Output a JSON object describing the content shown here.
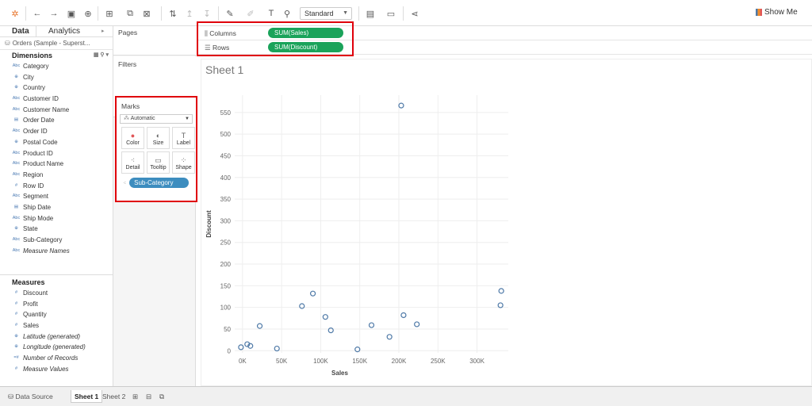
{
  "toolbar": {
    "view_mode": "Standard",
    "show_me": "Show Me",
    "icons": [
      "tableau-logo-icon",
      "undo-icon",
      "redo-icon",
      "save-icon",
      "add-datasource-icon",
      "new-worksheet-icon",
      "duplicate-icon",
      "clear-icon",
      "swap-icon",
      "sort-asc-icon",
      "sort-desc-icon",
      "highlight-icon",
      "group-icon",
      "label-icon",
      "pin-icon",
      "chart-icon",
      "presentation-icon",
      "share-icon"
    ]
  },
  "data_pane": {
    "tabs": [
      "Data",
      "Analytics"
    ],
    "datasource": "Orders (Sample - Superst...",
    "dimensions_title": "Dimensions",
    "dimensions": [
      {
        "type": "Abc",
        "label": "Category"
      },
      {
        "type": "globe",
        "label": "City"
      },
      {
        "type": "globe",
        "label": "Country"
      },
      {
        "type": "Abc",
        "label": "Customer ID"
      },
      {
        "type": "Abc",
        "label": "Customer Name"
      },
      {
        "type": "date",
        "label": "Order Date"
      },
      {
        "type": "Abc",
        "label": "Order ID"
      },
      {
        "type": "globe",
        "label": "Postal Code"
      },
      {
        "type": "Abc",
        "label": "Product ID"
      },
      {
        "type": "Abc",
        "label": "Product Name"
      },
      {
        "type": "Abc",
        "label": "Region"
      },
      {
        "type": "#",
        "label": "Row ID"
      },
      {
        "type": "Abc",
        "label": "Segment"
      },
      {
        "type": "date",
        "label": "Ship Date"
      },
      {
        "type": "Abc",
        "label": "Ship Mode"
      },
      {
        "type": "globe",
        "label": "State"
      },
      {
        "type": "Abc",
        "label": "Sub-Category"
      },
      {
        "type": "Abc",
        "label": "Measure Names",
        "italic": true
      }
    ],
    "measures_title": "Measures",
    "measures": [
      {
        "type": "#",
        "label": "Discount"
      },
      {
        "type": "#",
        "label": "Profit"
      },
      {
        "type": "#",
        "label": "Quantity"
      },
      {
        "type": "#",
        "label": "Sales"
      },
      {
        "type": "globe",
        "label": "Latitude (generated)",
        "italic": true
      },
      {
        "type": "globe",
        "label": "Longitude (generated)",
        "italic": true
      },
      {
        "type": "=#",
        "label": "Number of Records",
        "italic": true
      },
      {
        "type": "#",
        "label": "Measure Values",
        "italic": true
      }
    ]
  },
  "cards": {
    "pages": "Pages",
    "filters": "Filters",
    "marks": "Marks",
    "marks_type": "Automatic",
    "mark_buttons": [
      {
        "label": "Color",
        "icon": "color-icon"
      },
      {
        "label": "Size",
        "icon": "size-icon"
      },
      {
        "label": "Label",
        "icon": "label-icon"
      },
      {
        "label": "Detail",
        "icon": "detail-icon"
      },
      {
        "label": "Tooltip",
        "icon": "tooltip-icon"
      },
      {
        "label": "Shape",
        "icon": "shape-icon"
      }
    ],
    "detail_pill": "Sub-Category"
  },
  "shelves": {
    "columns_label": "Columns",
    "columns_pill": "SUM(Sales)",
    "rows_label": "Rows",
    "rows_pill": "SUM(Discount)"
  },
  "sheet": {
    "title": "Sheet 1"
  },
  "bottom_tabs": {
    "datasource": "Data Source",
    "sheets": [
      "Sheet 1",
      "Sheet 2"
    ],
    "active": "Sheet 1"
  },
  "colors": {
    "accent_green": "#1aa35a",
    "accent_blue": "#3d8dbf",
    "mark": "#4e79a7",
    "highlight": "#e0000b"
  },
  "chart_data": {
    "type": "scatter",
    "xlabel": "Sales",
    "ylabel": "Discount",
    "xlim": [
      -10000,
      340000
    ],
    "ylim": [
      -5,
      590
    ],
    "x_ticks": [
      0,
      50000,
      100000,
      150000,
      200000,
      250000,
      300000
    ],
    "x_tick_labels": [
      "0K",
      "50K",
      "100K",
      "150K",
      "200K",
      "250K",
      "300K"
    ],
    "y_ticks": [
      0,
      50,
      100,
      150,
      200,
      250,
      300,
      350,
      400,
      450,
      500,
      550
    ],
    "grid": true,
    "points": [
      {
        "x": -2000,
        "y": 8
      },
      {
        "x": 6000,
        "y": 15
      },
      {
        "x": 10000,
        "y": 11
      },
      {
        "x": 22000,
        "y": 57
      },
      {
        "x": 44000,
        "y": 5
      },
      {
        "x": 76000,
        "y": 103
      },
      {
        "x": 90000,
        "y": 132
      },
      {
        "x": 106000,
        "y": 78
      },
      {
        "x": 113000,
        "y": 47
      },
      {
        "x": 147000,
        "y": 3
      },
      {
        "x": 165000,
        "y": 59
      },
      {
        "x": 188000,
        "y": 32
      },
      {
        "x": 203000,
        "y": 566
      },
      {
        "x": 206000,
        "y": 82
      },
      {
        "x": 223000,
        "y": 61
      },
      {
        "x": 330000,
        "y": 105
      },
      {
        "x": 331000,
        "y": 138
      }
    ]
  }
}
